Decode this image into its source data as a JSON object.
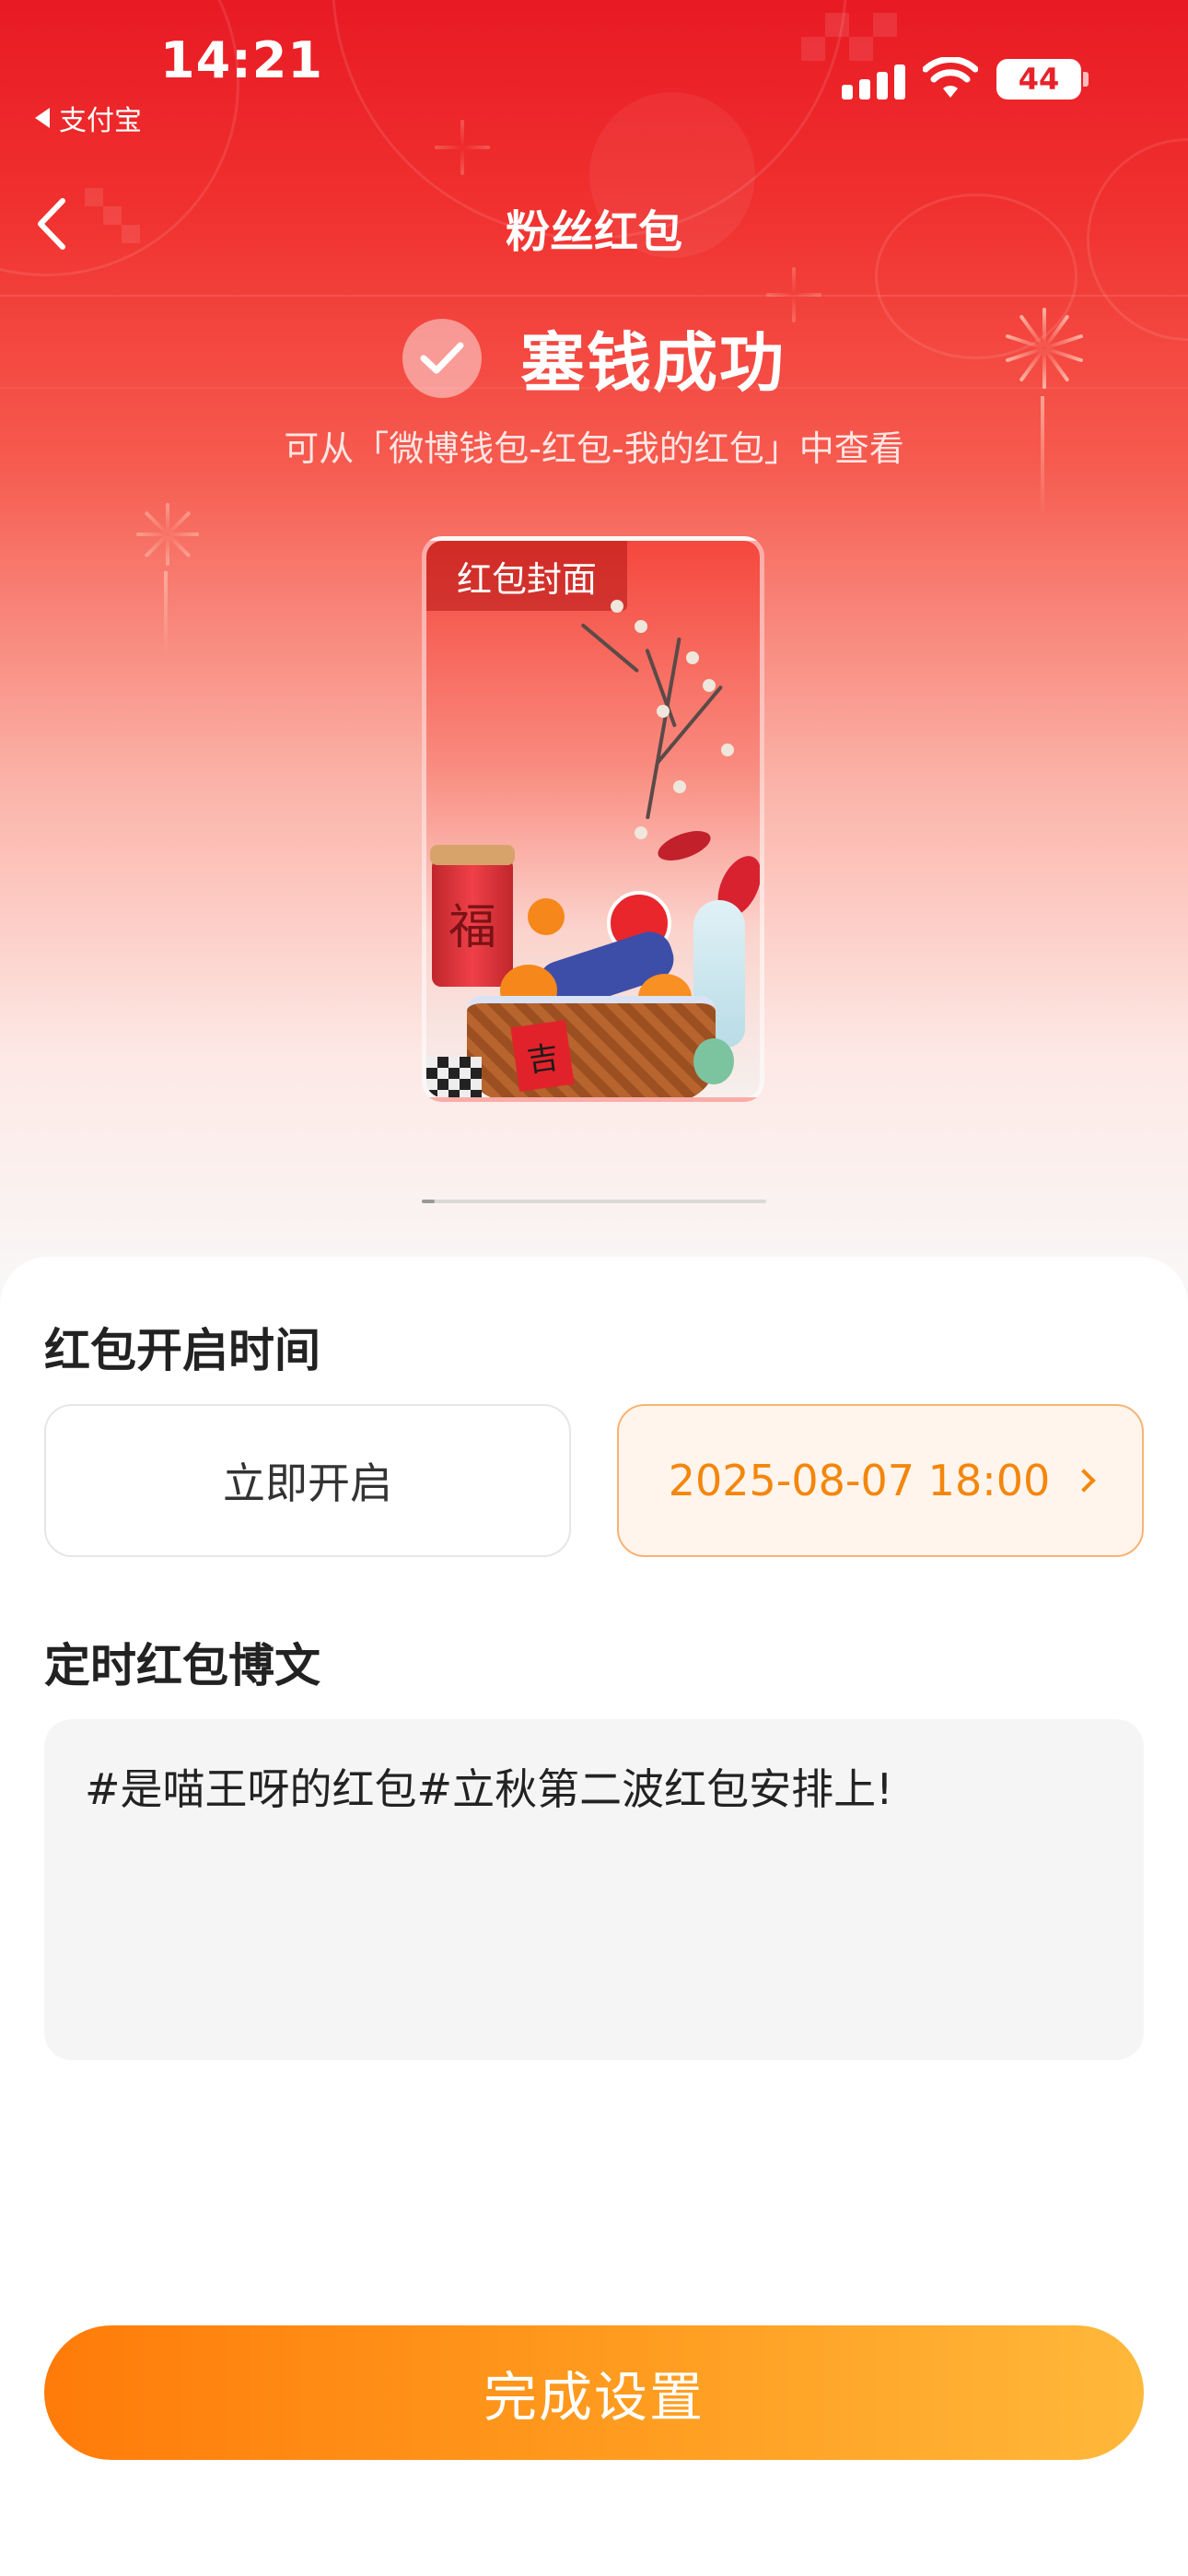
{
  "status_bar": {
    "time": "14:21",
    "back_app": "支付宝",
    "battery": "44"
  },
  "nav": {
    "title": "粉丝红包",
    "back_icon": "chevron-left-icon"
  },
  "success": {
    "title": "塞钱成功",
    "subtitle": "可从「微博钱包-红包-我的红包」中查看",
    "icon": "check-icon"
  },
  "cover": {
    "label": "红包封面",
    "fu_char": "福",
    "box_char": "吉"
  },
  "open_time": {
    "label": "红包开启时间",
    "options": [
      {
        "label": "立即开启",
        "selected": false
      },
      {
        "label": "2025-08-07 18:00",
        "selected": true
      }
    ]
  },
  "post": {
    "label": "定时红包博文",
    "text": "#是喵王呀的红包#立秋第二波红包安排上!"
  },
  "finish_button": "完成设置",
  "colors": {
    "brand_red": "#e81a24",
    "accent_orange": "#f4860c",
    "button_gradient_start": "#ff7b0a",
    "button_gradient_end": "#ffb83a"
  }
}
